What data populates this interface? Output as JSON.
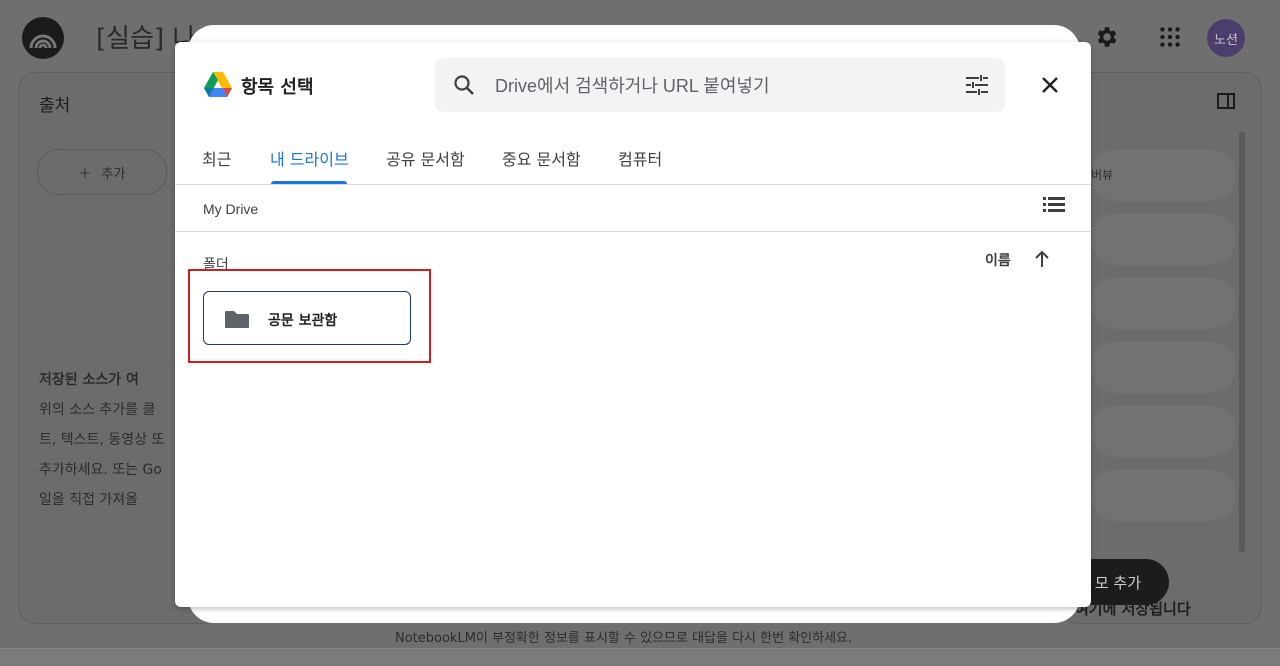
{
  "app": {
    "title": "[실습] 나의",
    "avatar": "노션",
    "sources_title": "출처",
    "add_label": "추가",
    "empty_title": "저장된 소스가 여",
    "empty_lines": [
      "위의 소스 추가를 클",
      "트, 텍스트, 동영상 또",
      "추가하세요. 또는 Go",
      "일을 직접 가져올"
    ],
    "right_pill_text": "버뷰",
    "memo_button": "모 추가",
    "save_note": "여기에 저장됩니다",
    "footer_note": "NotebookLM이 부정확한 정보를 표시할 수 있으므로 대답을 다시 한번 확인하세요."
  },
  "modal": {
    "title": "항목 선택",
    "search_placeholder": "Drive에서 검색하거나 URL 붙여넣기",
    "tabs": [
      {
        "label": "최근"
      },
      {
        "label": "내 드라이브"
      },
      {
        "label": "공유 문서함"
      },
      {
        "label": "중요 문서함"
      },
      {
        "label": "컴퓨터"
      }
    ],
    "active_tab": "내 드라이브",
    "breadcrumb": "My Drive",
    "section_label": "폴더",
    "sort_label": "이름",
    "folders": [
      {
        "name": "공문 보관함"
      }
    ]
  },
  "colors": {
    "accent": "#1a73e8",
    "highlight": "#cc1f1f"
  }
}
